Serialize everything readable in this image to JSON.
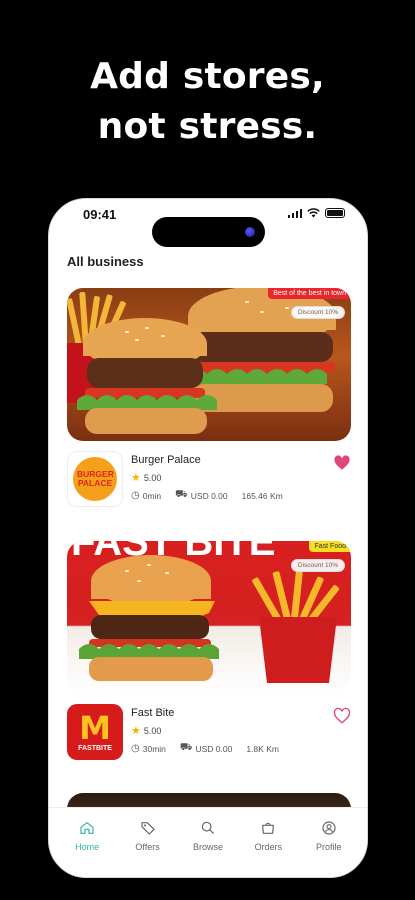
{
  "headline": "Add stores, not stress.",
  "status": {
    "time": "09:41"
  },
  "section_title": "All business",
  "stores": [
    {
      "badge": "Best of the best in town",
      "discount": "Discount 10%",
      "name": "Burger Palace",
      "logo_text": "BURGER PALACE",
      "rating": "5.00",
      "time": "0min",
      "fee": "USD 0.00",
      "distance": "165.46 Km",
      "favorited": true
    },
    {
      "badge": "Fast Food",
      "discount": "Discount 10%",
      "name": "Fast Bite",
      "logo_text": "FASTBITE",
      "logo_mark": "M",
      "rating": "5.00",
      "time": "30min",
      "fee": "USD 0.00",
      "distance": "1.8K Km",
      "favorited": false,
      "banner_text": "FAST BITE"
    }
  ],
  "tabs": [
    {
      "label": "Home",
      "icon": "home-icon",
      "active": true
    },
    {
      "label": "Offers",
      "icon": "tag-icon",
      "active": false
    },
    {
      "label": "Browse",
      "icon": "search-icon",
      "active": false
    },
    {
      "label": "Orders",
      "icon": "bag-icon",
      "active": false
    },
    {
      "label": "Profile",
      "icon": "profile-icon",
      "active": false
    }
  ],
  "colors": {
    "accent": "#36b39a",
    "favorite": "#e0457b",
    "badge_red": "#e9252d",
    "badge_yellow": "#f5df1e"
  }
}
